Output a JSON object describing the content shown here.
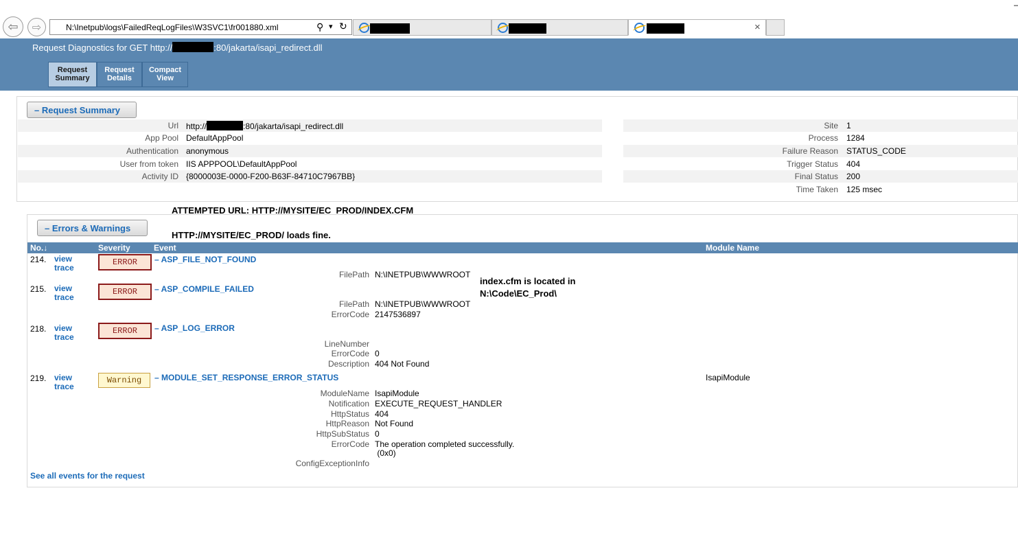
{
  "browser": {
    "address": "N:\\Inetpub\\logs\\FailedReqLogFiles\\W3SVC1\\fr001880.xml",
    "close_glyph": "×",
    "back_glyph": "⇦",
    "forward_glyph": "⇨",
    "search_glyph": "⚲",
    "dropdown_glyph": "▾",
    "refresh_glyph": "↻"
  },
  "header": {
    "title_prefix": "Request Diagnostics for GET http://",
    "title_suffix": ":80/jakarta/isapi_redirect.dll",
    "tabs": [
      {
        "label": "Request\nSummary"
      },
      {
        "label": "Request\nDetails"
      },
      {
        "label": "Compact\nView"
      }
    ]
  },
  "summary": {
    "section_label": "–  Request Summary",
    "left": [
      {
        "label": "Url",
        "value_prefix": "http://",
        "value_suffix": ":80/jakarta/isapi_redirect.dll"
      },
      {
        "label": "App Pool",
        "value": "DefaultAppPool"
      },
      {
        "label": "Authentication",
        "value": "anonymous"
      },
      {
        "label": "User from token",
        "value": "IIS APPPOOL\\DefaultAppPool"
      },
      {
        "label": "Activity ID",
        "value": "{8000003E-0000-F200-B63F-84710C7967BB}"
      }
    ],
    "right": [
      {
        "label": "Site",
        "value": "1"
      },
      {
        "label": "Process",
        "value": "1284"
      },
      {
        "label": "Failure Reason",
        "value": "STATUS_CODE"
      },
      {
        "label": "Trigger Status",
        "value": "404"
      },
      {
        "label": "Final Status",
        "value": "200"
      },
      {
        "label": "Time Taken",
        "value": "125 msec"
      }
    ]
  },
  "notes": {
    "attempted": "ATTEMPTED URL: HTTP://MYSITE/EC_PROD/INDEX.CFM",
    "loads": "HTTP://MYSITE/EC_PROD/ loads fine.",
    "located_1": "index.cfm is located in",
    "located_2": "N:\\Code\\EC_Prod\\"
  },
  "errors": {
    "section_label": "–  Errors & Warnings",
    "columns": {
      "no": "No.↓",
      "severity": "Severity",
      "event": "Event",
      "module": "Module Name"
    },
    "view": "view",
    "trace": "trace",
    "events": [
      {
        "no": "214.",
        "severity": "ERROR",
        "name": "–  ASP_FILE_NOT_FOUND",
        "module": "",
        "props": [
          {
            "k": "FilePath",
            "v": "N:\\INETPUB\\WWWROOT"
          }
        ]
      },
      {
        "no": "215.",
        "severity": "ERROR",
        "name": "–  ASP_COMPILE_FAILED",
        "module": "",
        "props": [
          {
            "k": "FilePath",
            "v": "N:\\INETPUB\\WWWROOT"
          },
          {
            "k": "ErrorCode",
            "v": "2147536897"
          }
        ]
      },
      {
        "no": "218.",
        "severity": "ERROR",
        "name": "–  ASP_LOG_ERROR",
        "module": "",
        "props": [
          {
            "k": "LineNumber",
            "v": ""
          },
          {
            "k": "ErrorCode",
            "v": "0"
          },
          {
            "k": "Description",
            "v": "404 Not Found"
          }
        ]
      },
      {
        "no": "219.",
        "severity": "Warning",
        "name": "–  MODULE_SET_RESPONSE_ERROR_STATUS",
        "module": "IsapiModule",
        "props": [
          {
            "k": "ModuleName",
            "v": "IsapiModule"
          },
          {
            "k": "Notification",
            "v": "EXECUTE_REQUEST_HANDLER"
          },
          {
            "k": "HttpStatus",
            "v": "404"
          },
          {
            "k": "HttpReason",
            "v": "Not Found"
          },
          {
            "k": "HttpSubStatus",
            "v": "0"
          },
          {
            "k": "ErrorCode",
            "v": "The operation completed successfully."
          },
          {
            "k": "",
            "v": " (0x0)"
          },
          {
            "k": "ConfigExceptionInfo",
            "v": ""
          }
        ]
      }
    ],
    "see_all": "See all events for the request"
  },
  "colors": {
    "header": "#5b87b1",
    "link": "#1c6bb8",
    "error_border": "#8b1a1a",
    "warning_bg": "#fff8d0"
  }
}
